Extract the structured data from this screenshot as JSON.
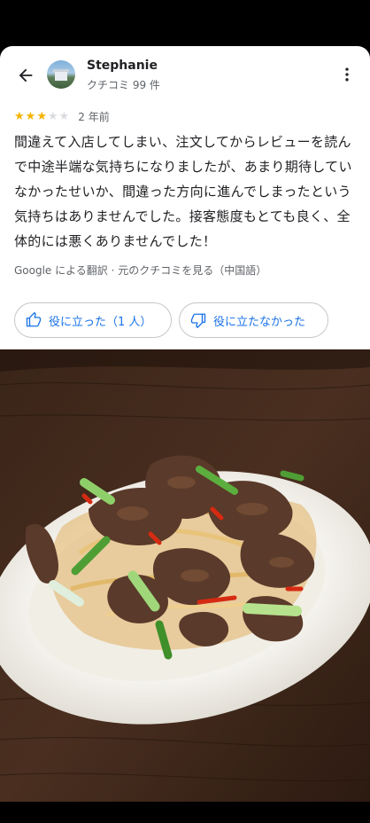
{
  "reviewer": {
    "name": "Stephanie",
    "review_count": "クチコミ 99 件"
  },
  "review": {
    "rating": 3,
    "max_rating": 5,
    "date": "2 年前",
    "text": "間違えて入店してしまい、注文してからレビューを読んで中途半端な気持ちになりましたが、あまり期待していなかったせいか、間違った方向に進んでしまったという気持ちはありませんでした。接客態度もとても良く、全体的には悪くありませんでした！",
    "translation_note": "Google による翻訳 · 元のクチコミを見る（中国語）"
  },
  "actions": {
    "helpful_label": "役に立った（1 人）",
    "not_helpful_label": "役に立たなかった"
  },
  "icons": {
    "back": "arrow-back-icon",
    "more": "more-vert-icon",
    "helpful": "thumb-up-icon",
    "not_helpful": "thumb-down-icon"
  },
  "colors": {
    "accent": "#1a73e8",
    "star": "#f4b400",
    "star_empty": "#dadce0"
  }
}
